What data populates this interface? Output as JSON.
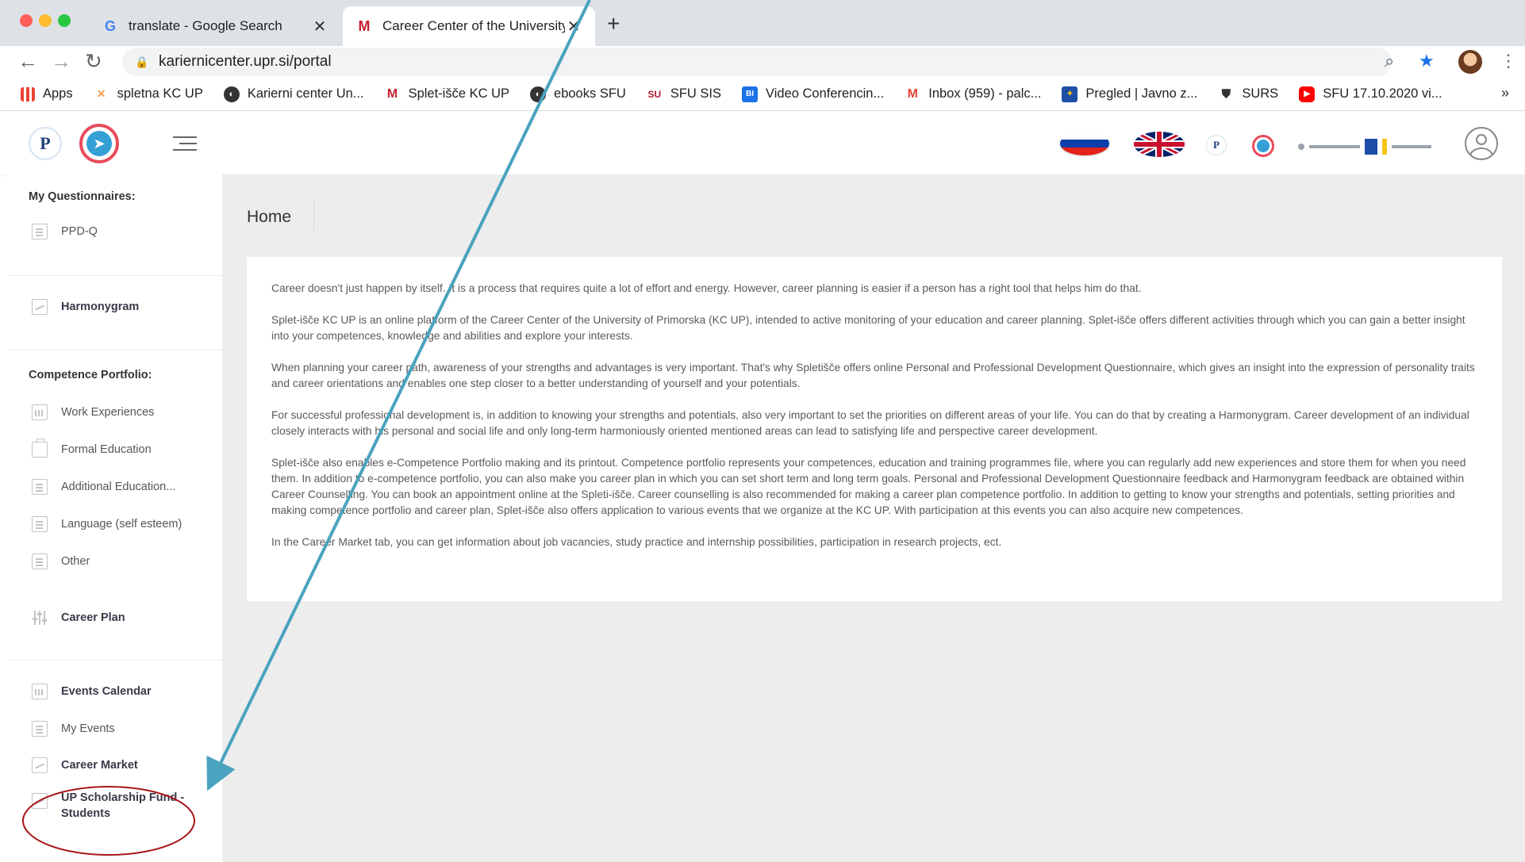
{
  "browser": {
    "tabs": [
      {
        "title": "translate - Google Search",
        "favicon": "G"
      },
      {
        "title": "Career Center of the University",
        "favicon": "M"
      }
    ],
    "url": "kariernicenter.upr.si/portal",
    "bookmarks": [
      {
        "label": "Apps",
        "icon": "apps-grid-icon"
      },
      {
        "label": "spletna KC UP",
        "icon": "kc-up-icon"
      },
      {
        "label": "Karierni center Un...",
        "icon": "globe-icon"
      },
      {
        "label": "Splet-išče KC UP",
        "icon": "m-logo-icon"
      },
      {
        "label": "ebooks SFU",
        "icon": "globe-icon"
      },
      {
        "label": "SFU SIS",
        "icon": "sfu-icon"
      },
      {
        "label": "Video Conferencin...",
        "icon": "bi-icon"
      },
      {
        "label": "Inbox (959) - palc...",
        "icon": "gmail-icon"
      },
      {
        "label": "Pregled | Javno z...",
        "icon": "eu-flag-icon"
      },
      {
        "label": "SURS",
        "icon": "surs-icon"
      },
      {
        "label": "SFU 17.10.2020 vi...",
        "icon": "youtube-icon"
      }
    ]
  },
  "sidebar": {
    "questionnaires_header": "My Questionnaires:",
    "ppdq": "PPD-Q",
    "harmonygram": "Harmonygram",
    "competence_header": "Competence Portfolio:",
    "work_experiences": "Work Experiences",
    "formal_education": "Formal Education",
    "additional_education": "Additional Education...",
    "language": "Language (self esteem)",
    "other": "Other",
    "career_plan": "Career Plan",
    "events_calendar": "Events Calendar",
    "my_events": "My Events",
    "career_market": "Career Market",
    "scholarship_line1": "UP Scholarship Fund -",
    "scholarship_line2": "Students"
  },
  "main": {
    "title": "Home",
    "paragraphs": [
      "Career doesn't just happen by itself. It is a process that requires quite a lot of effort and energy. However, career planning is easier if a person has a right tool that helps him do that.",
      "Splet-išče KC UP is an online platform of the Career Center of the University of Primorska (KC UP), intended to active monitoring of your education and career planning. Splet-išče offers different activities through which you can gain a better insight into your competences, knowledge and abilities and explore your interests.",
      "When planning your career path, awareness of your strengths and advantages is very important. That's why Spletišče offers online Personal and Professional Development Questionnaire, which gives an insight into the expression of personality traits and career orientations and enables one step closer to a better understanding of yourself and your potentials.",
      "For successful professional development is, in addition to knowing your strengths and potentials, also very important to set the priorities on different areas of your life. You can do that by creating a Harmonygram. Career development of an individual closely interacts with his personal and social life and only long-term harmoniously oriented mentioned areas can lead to satisfying life and perspective career development.",
      "Splet-išče also enables e-Competence Portfolio making and its printout. Competence portfolio represents your competences, education and training programmes file, where you can regularly add new experiences and store them for when you need them. In addition to e-competence portfolio, you can also make you career plan in which you can set short term and long term goals. Personal and Professional Development Questionnaire feedback and Harmonygram feedback are obtained within Career Counselling. You can book an appointment online at the Spleti-išče. Career counselling is also recommended for making a career plan competence portfolio. In addition to getting to know your strengths and potentials, setting priorities and making competence portfolio and career plan, Splet-išče also offers application to various events that we organize at the KC UP. With participation at this events you can also acquire new competences.",
      "In the Career Market tab, you can get information about job vacancies, study practice and internship possibilities, participation in research projects, ect."
    ]
  },
  "annotation": {
    "arrow_color": "#4aa3bf",
    "circle_color": "#a8161b"
  }
}
